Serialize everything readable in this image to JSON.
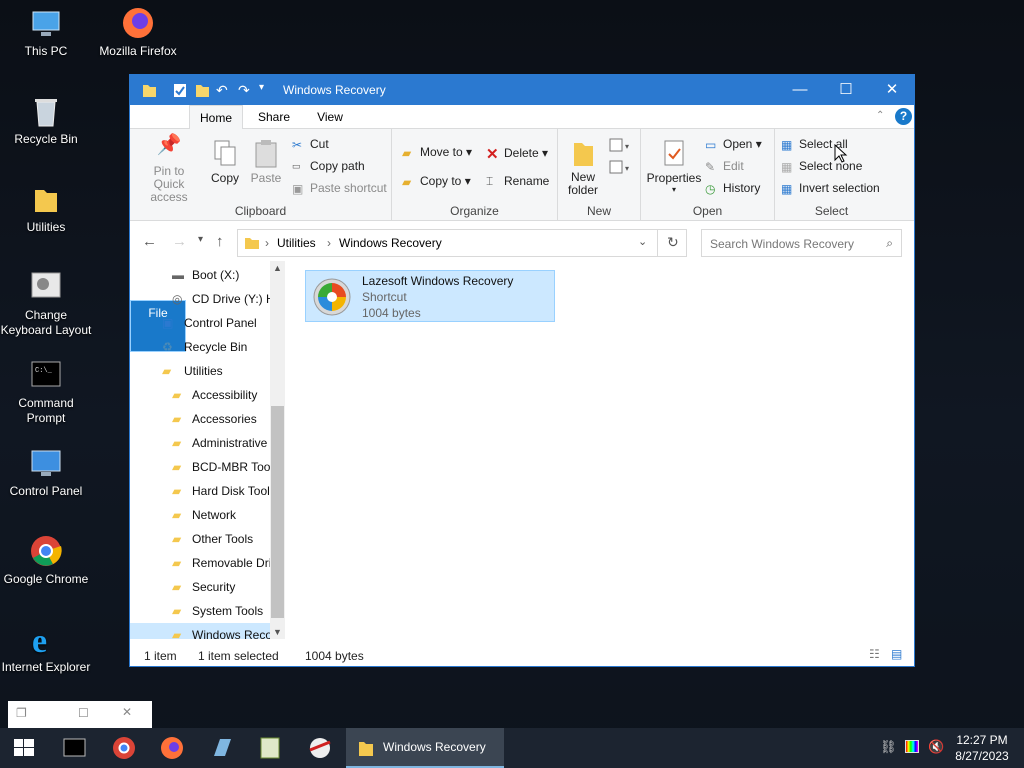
{
  "desktop": {
    "icons": [
      {
        "label": "This PC",
        "icon": "this-pc-icon"
      },
      {
        "label": "Mozilla Firefox",
        "icon": "firefox-icon"
      },
      {
        "label": "Recycle Bin",
        "icon": "recycle-bin-icon"
      },
      {
        "label": "Utilities",
        "icon": "folder-icon"
      },
      {
        "label": "Change Keyboard Layout",
        "icon": "keyboard-icon"
      },
      {
        "label": "Command Prompt",
        "icon": "cmd-icon"
      },
      {
        "label": "Control Panel",
        "icon": "control-panel-icon"
      },
      {
        "label": "Google Chrome",
        "icon": "chrome-icon"
      },
      {
        "label": "Internet Explorer",
        "icon": "ie-icon"
      }
    ]
  },
  "window": {
    "title": "Windows Recovery",
    "accent": "#2b79d0",
    "tabs": [
      "File",
      "Home",
      "Share",
      "View"
    ],
    "clipboard": {
      "pin": "Pin to Quick access",
      "copy": "Copy",
      "paste": "Paste",
      "cut": "Cut",
      "copy_path": "Copy path",
      "paste_shortcut": "Paste shortcut",
      "label": "Clipboard"
    },
    "organize": {
      "move_to": "Move to",
      "copy_to": "Copy to",
      "delete": "Delete",
      "rename": "Rename",
      "label": "Organize"
    },
    "new": {
      "new_folder": "New folder",
      "label": "New"
    },
    "open": {
      "properties": "Properties",
      "open": "Open",
      "edit": "Edit",
      "history": "History",
      "label": "Open"
    },
    "select": {
      "select_all": "Select all",
      "select_none": "Select none",
      "invert": "Invert selection",
      "label": "Select"
    },
    "address": {
      "crumbs": [
        "Utilities",
        "Windows Recovery"
      ],
      "search_placeholder": "Search Windows Recovery"
    },
    "nav": [
      "Boot (X:)",
      "CD Drive (Y:) H",
      "Control Panel",
      "Recycle Bin",
      "Utilities",
      "Accessibility",
      "Accessories",
      "Administrative",
      "BCD-MBR Tool",
      "Hard Disk Tools",
      "Network",
      "Other Tools",
      "Removable Dri",
      "Security",
      "System Tools",
      "Windows Reco"
    ],
    "file": {
      "name": "Lazesoft Windows Recovery",
      "type": "Shortcut",
      "size": "1004 bytes"
    },
    "status": {
      "count": "1 item",
      "selected": "1 item selected",
      "size": "1004 bytes"
    }
  },
  "taskbar": {
    "active_label": "Windows Recovery",
    "time": "12:27 PM",
    "date": "8/27/2023"
  }
}
